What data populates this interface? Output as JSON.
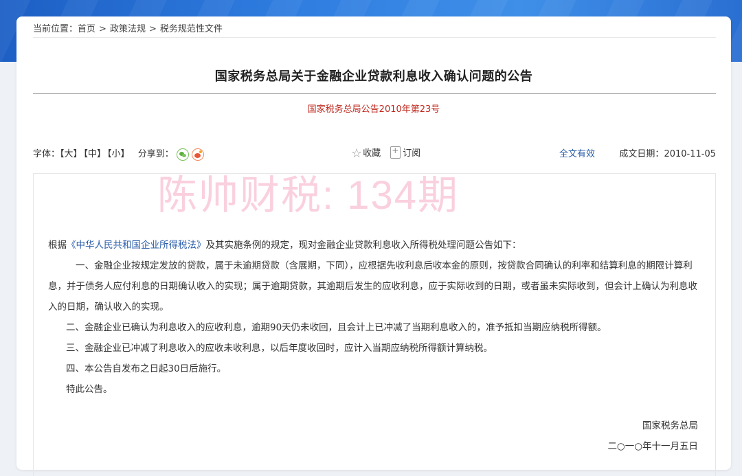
{
  "breadcrumb": {
    "prefix": "当前位置：",
    "items": [
      "首页",
      "政策法规",
      "税务规范性文件"
    ],
    "separator": ">"
  },
  "article": {
    "title": "国家税务总局关于金融企业贷款利息收入确认问题的公告",
    "doc_no": "国家税务总局公告2010年第23号"
  },
  "toolbar": {
    "font_label": "字体：",
    "font_large": "【大】",
    "font_medium": "【中】",
    "font_small": "【小】",
    "share_label": "分享到：",
    "favorite": "收藏",
    "subscribe": "订阅",
    "validity": "全文有效",
    "date_label": "成文日期：",
    "date_value": "2010-11-05"
  },
  "watermark": "陈帅财税: 134期",
  "body": {
    "intro_pre": "根据",
    "intro_law": "《中华人民共和国企业所得税法》",
    "intro_post": "及其实施条例的规定，现对金融企业贷款利息收入所得税处理问题公告如下：",
    "p1": "一、金融企业按规定发放的贷款，属于未逾期贷款（含展期，下同），应根据先收利息后收本金的原则，按贷款合同确认的利率和结算利息的期限计算利息，并于债务人应付利息的日期确认收入的实现；属于逾期贷款，其逾期后发生的应收利息，应于实际收到的日期，或者虽未实际收到，但会计上确认为利息收入的日期，确认收入的实现。",
    "p2": "二、金融企业已确认为利息收入的应收利息，逾期90天仍未收回，且会计上已冲减了当期利息收入的，准予抵扣当期应纳税所得额。",
    "p3": "三、金融企业已冲减了利息收入的应收未收利息，以后年度收回时，应计入当期应纳税所得额计算纳税。",
    "p4": "四、本公告自发布之日起30日后施行。",
    "p5": "特此公告。"
  },
  "signature": {
    "org": "国家税务总局",
    "date": "二○一○年十一月五日"
  },
  "colors": {
    "doc_no": "#c0281e",
    "link": "#2a5daa",
    "header_band": "#2f7de0"
  }
}
